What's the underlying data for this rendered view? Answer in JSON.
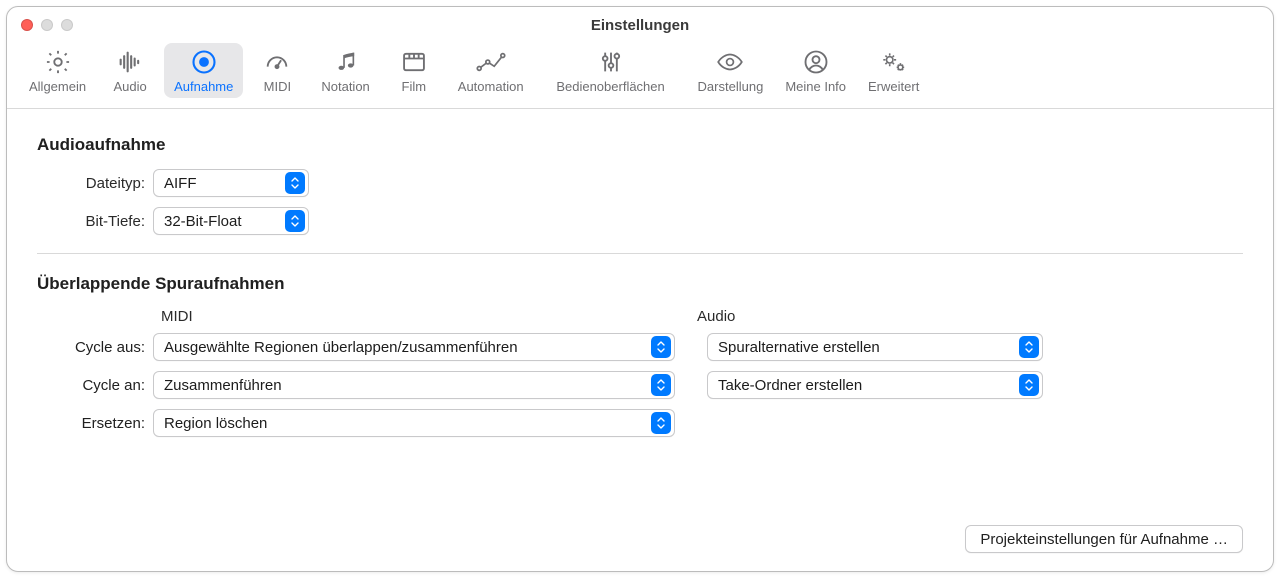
{
  "window": {
    "title": "Einstellungen"
  },
  "tabs": [
    {
      "id": "allgemein",
      "label": "Allgemein"
    },
    {
      "id": "audio",
      "label": "Audio"
    },
    {
      "id": "aufnahme",
      "label": "Aufnahme"
    },
    {
      "id": "midi",
      "label": "MIDI"
    },
    {
      "id": "notation",
      "label": "Notation"
    },
    {
      "id": "film",
      "label": "Film"
    },
    {
      "id": "automation",
      "label": "Automation"
    },
    {
      "id": "bedienoberflaechen",
      "label": "Bedienoberflächen"
    },
    {
      "id": "darstellung",
      "label": "Darstellung"
    },
    {
      "id": "meine-info",
      "label": "Meine Info"
    },
    {
      "id": "erweitert",
      "label": "Erweitert"
    }
  ],
  "selected_tab": "aufnahme",
  "audio_recording": {
    "title": "Audioaufnahme",
    "filetype_label": "Dateityp:",
    "filetype_value": "AIFF",
    "bitdepth_label": "Bit-Tiefe:",
    "bitdepth_value": "32-Bit-Float"
  },
  "overlapping": {
    "title": "Überlappende Spuraufnahmen",
    "col_midi": "MIDI",
    "col_audio": "Audio",
    "cycle_off_label": "Cycle aus:",
    "cycle_off_midi": "Ausgewählte Regionen überlappen/zusammenführen",
    "cycle_off_audio": "Spuralternative erstellen",
    "cycle_on_label": "Cycle an:",
    "cycle_on_midi": "Zusammenführen",
    "cycle_on_audio": "Take-Ordner erstellen",
    "replace_label": "Ersetzen:",
    "replace_midi": "Region löschen"
  },
  "footer": {
    "project_settings_button": "Projekteinstellungen für Aufnahme …"
  }
}
